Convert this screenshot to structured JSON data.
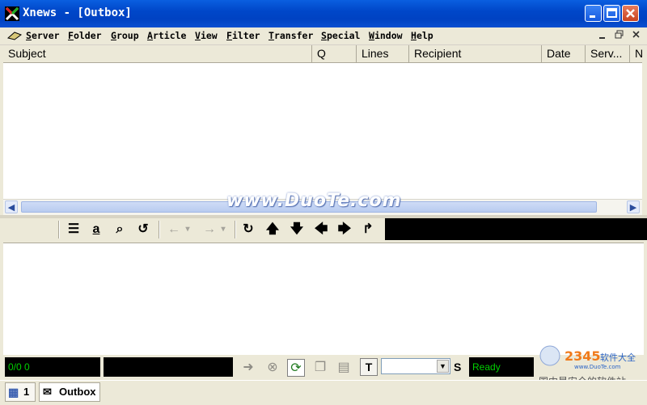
{
  "window": {
    "title": "Xnews - [Outbox]"
  },
  "menu": [
    {
      "u": "S",
      "rest": "erver"
    },
    {
      "u": "F",
      "rest": "older"
    },
    {
      "u": "G",
      "rest": "roup"
    },
    {
      "u": "A",
      "rest": "rticle"
    },
    {
      "u": "V",
      "rest": "iew"
    },
    {
      "u": "F",
      "rest": "ilter"
    },
    {
      "u": "T",
      "rest": "ransfer"
    },
    {
      "u": "S",
      "rest": "pecial"
    },
    {
      "u": "W",
      "rest": "indow"
    },
    {
      "u": "H",
      "rest": "elp"
    }
  ],
  "columns": [
    "Subject",
    "Q",
    "Lines",
    "Recipient",
    "Date",
    "Serv...",
    "N"
  ],
  "watermark": "www.DuoTe.com",
  "status": {
    "counter": "0/0 0",
    "ready": "Ready",
    "t_label": "T",
    "s_label": "S"
  },
  "taskbar": {
    "count": "1",
    "outbox": "Outbox"
  },
  "brand": {
    "caption": "国内最安全的软件站",
    "site": "www.DuoTe.com",
    "colors": {
      "orange": "#f07a1a",
      "blue": "#2a63c6"
    }
  },
  "colors": {
    "titlebar": "#0047c9",
    "status_green": "#00d000"
  }
}
